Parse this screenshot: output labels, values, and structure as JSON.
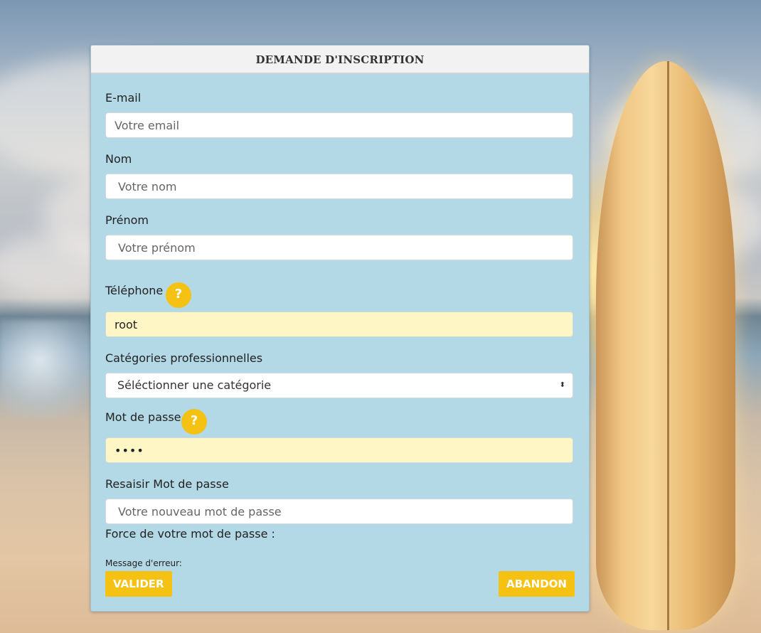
{
  "form": {
    "title": "DEMANDE D'INSCRIPTION",
    "email": {
      "label": "E-mail",
      "placeholder": "Votre email",
      "value": ""
    },
    "nom": {
      "label": "Nom",
      "placeholder": "Votre nom",
      "value": ""
    },
    "prenom": {
      "label": "Prénom",
      "placeholder": "Votre prénom",
      "value": ""
    },
    "telephone": {
      "label": "Téléphone",
      "help": "?",
      "value": "root"
    },
    "categories": {
      "label": "Catégories professionnelles",
      "selected": "Séléctionner une catégorie",
      "arrows": "⬍"
    },
    "password": {
      "label": "Mot de passe",
      "help": "?",
      "value": "••••"
    },
    "password_confirm": {
      "label": "Resaisir Mot de passe",
      "placeholder": "Votre nouveau mot de passe",
      "value": ""
    },
    "strength_label": "Force de votre mot de passe :",
    "error_label": "Message d'erreur:",
    "submit_label": "VALIDER",
    "cancel_label": "ABANDON"
  },
  "colors": {
    "panel_bg": "#b3d8e6",
    "accent": "#f5c214",
    "filled_input_bg": "#fff6c6"
  },
  "icons": {
    "help": "help-icon",
    "select": "select-arrows-icon"
  }
}
